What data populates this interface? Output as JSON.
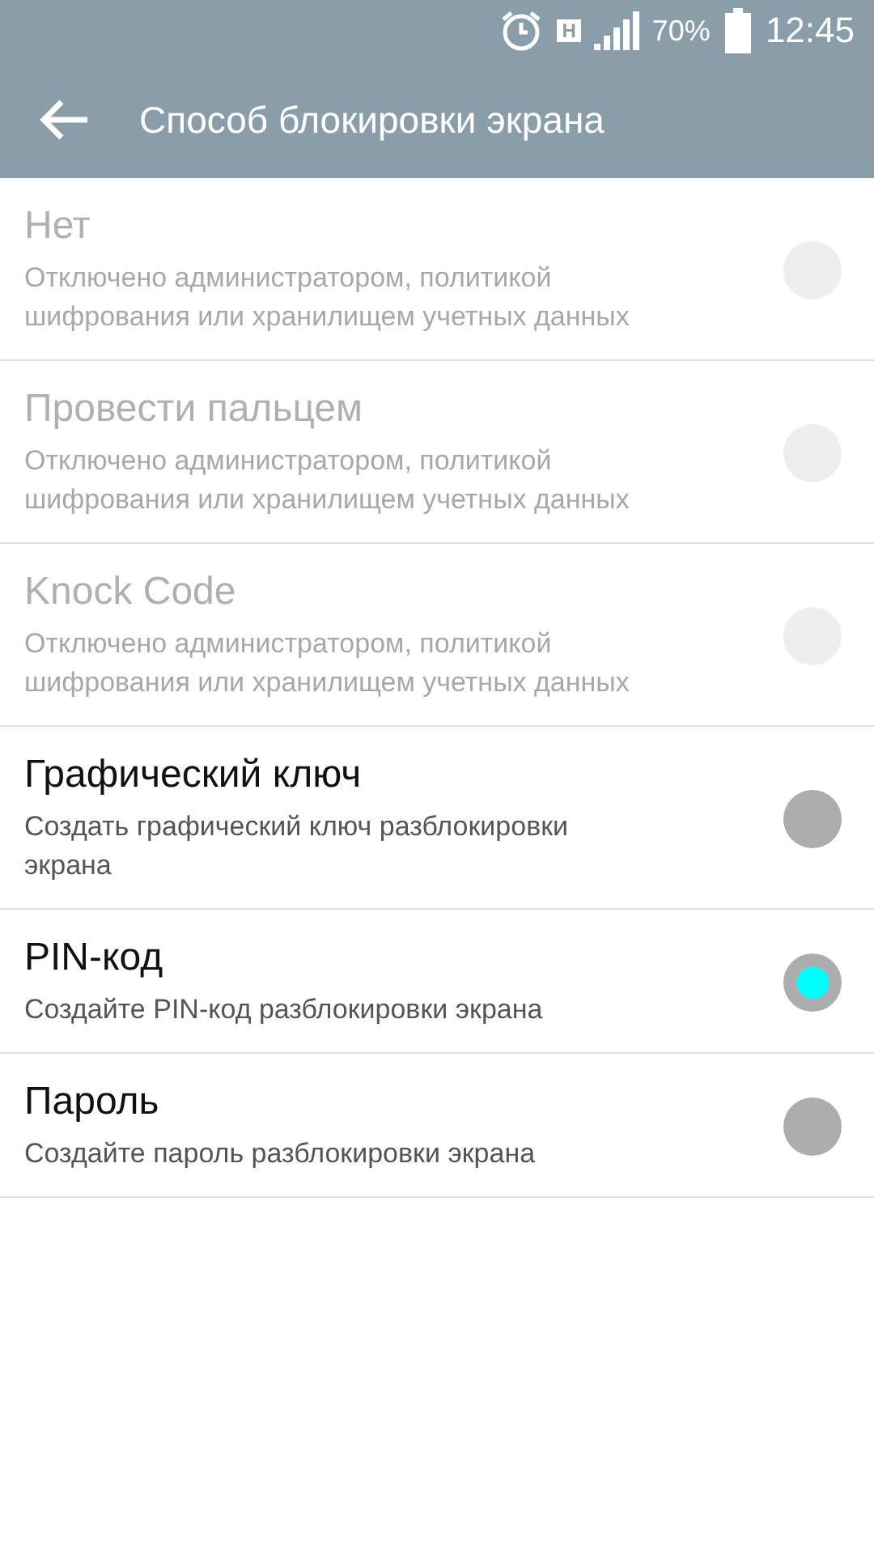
{
  "status_bar": {
    "network": "H",
    "battery": "70%",
    "time": "12:45"
  },
  "header": {
    "title": "Способ блокировки экрана"
  },
  "options": [
    {
      "title": "Нет",
      "subtitle": "Отключено администратором, политикой шифрования или хранилищем учетных данных",
      "disabled": true,
      "selected": false
    },
    {
      "title": "Провести пальцем",
      "subtitle": "Отключено администратором, политикой шифрования или хранилищем учетных данных",
      "disabled": true,
      "selected": false
    },
    {
      "title": "Knock Code",
      "subtitle": "Отключено администратором, политикой шифрования или хранилищем учетных данных",
      "disabled": true,
      "selected": false
    },
    {
      "title": "Графический ключ",
      "subtitle": "Создать графический ключ разблокировки экрана",
      "disabled": false,
      "selected": false
    },
    {
      "title": "PIN-код",
      "subtitle": "Создайте PIN-код разблокировки экрана",
      "disabled": false,
      "selected": true
    },
    {
      "title": "Пароль",
      "subtitle": "Создайте пароль разблокировки экрана",
      "disabled": false,
      "selected": false
    }
  ]
}
